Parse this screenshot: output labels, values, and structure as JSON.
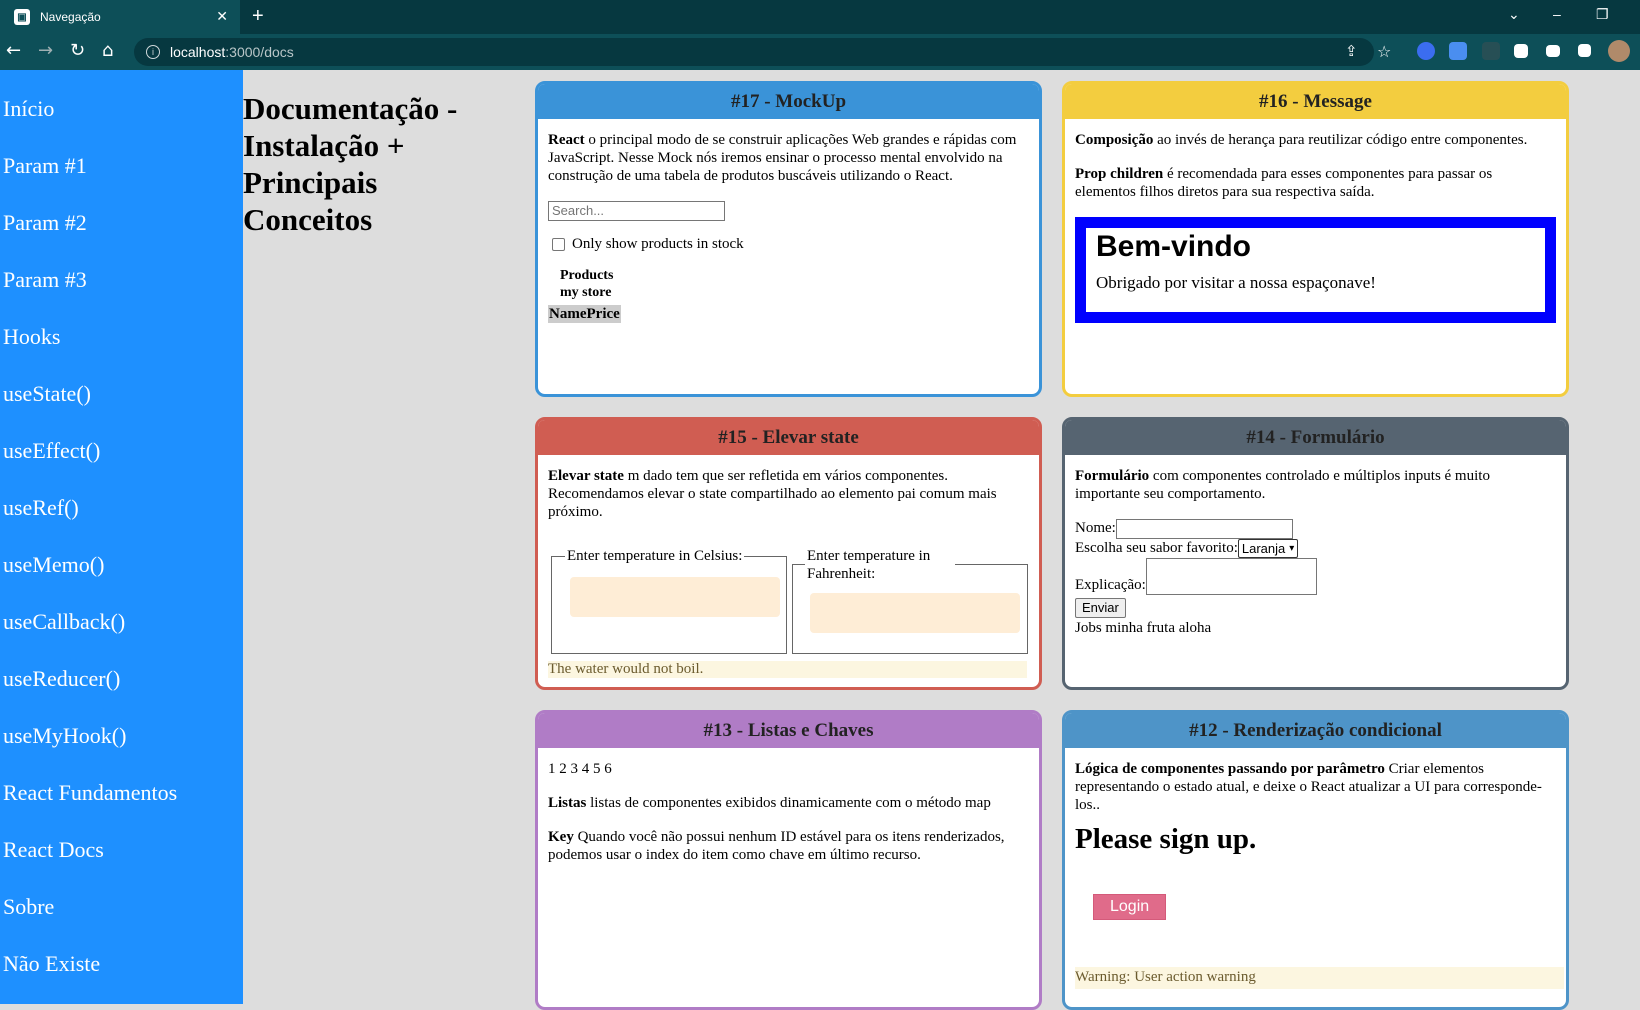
{
  "browser": {
    "tab_title": "Navegação",
    "tab_close": "✕",
    "new_tab": "+",
    "url_host": "localhost",
    "url_path": ":3000/docs"
  },
  "sidebar": {
    "items": [
      {
        "label": "Início"
      },
      {
        "label": "Param #1"
      },
      {
        "label": "Param #2"
      },
      {
        "label": "Param #3"
      },
      {
        "label": "Hooks"
      },
      {
        "label": "useState()"
      },
      {
        "label": "useEffect()"
      },
      {
        "label": "useRef()"
      },
      {
        "label": "useMemo()"
      },
      {
        "label": "useCallback()"
      },
      {
        "label": "useReducer()"
      },
      {
        "label": "useMyHook()"
      },
      {
        "label": "React Fundamentos"
      },
      {
        "label": "React Docs"
      },
      {
        "label": "Sobre"
      },
      {
        "label": "Não Existe"
      }
    ]
  },
  "page": {
    "title": "Documentação - Instalação + Principais Conceitos"
  },
  "colors": {
    "sidebar": "#1e90ff",
    "card17": "#3a93d8",
    "card16": "#f3cd3f",
    "card15": "#d05d52",
    "card14": "#566471",
    "card13": "#b07cc6",
    "card12": "#4e94c8"
  },
  "cards": {
    "c17": {
      "title": "#17 - MockUp",
      "bold": "React",
      "text": " o principal modo de se construir aplicações Web grandes e rápidas com JavaScript. Nesse Mock nós iremos ensinar o processo mental envolvido na construção de uma tabela de produtos buscáveis utilizando o React.",
      "search_placeholder": "Search...",
      "checkbox_label": "Only show products in stock",
      "caption_line1": "Products",
      "caption_line2": "my store",
      "col_name": "Name",
      "col_price": "Price"
    },
    "c16": {
      "title": "#16 - Message",
      "p1_bold": "Composição",
      "p1_text": " ao invés de herança para reutilizar código entre componentes.",
      "p2_bold": "Prop children",
      "p2_text": " é recomendada para esses componentes para passar os elementos filhos diretos para sua respectiva saída.",
      "welcome_title": "Bem-vindo",
      "welcome_text": "Obrigado por visitar a nossa espaçonave!"
    },
    "c15": {
      "title": "#15 - Elevar state",
      "bold": "Elevar state",
      "text": " m dado tem que ser refletida em vários componentes. Recomendamos elevar o state compartilhado ao elemento pai comum mais próximo.",
      "legend_c": "Enter temperature in Celsius:",
      "legend_f": "Enter temperature in Fahrenheit:",
      "verdict": "The water would not boil."
    },
    "c14": {
      "title": "#14 - Formulário",
      "bold": "Formulário",
      "text": " com componentes controlado e múltiplos inputs é muito importante seu comportamento.",
      "name_label": "Nome:",
      "flavor_label": "Escolha seu sabor favorito:",
      "flavor_value": "Laranja",
      "explain_label": "Explicação:",
      "submit": "Enviar",
      "output": "Jobs minha fruta aloha"
    },
    "c13": {
      "title": "#13 - Listas e Chaves",
      "numbers": "1 2 3 4 5 6",
      "p1_bold": "Listas",
      "p1_text": " listas de componentes exibidos dinamicamente com o método map",
      "p2_bold": "Key",
      "p2_text": " Quando você não possui nenhum ID estável para os itens renderizados, podemos usar o index do item como chave em último recurso."
    },
    "c12": {
      "title": "#12 - Renderização condicional",
      "bold": "Lógica de componentes passando por parâmetro",
      "text": " Criar elementos representando o estado atual, e deixe o React atualizar a UI para corresponde-los..",
      "heading": "Please sign up.",
      "login": "Login",
      "warning": "Warning: User action warning"
    }
  }
}
